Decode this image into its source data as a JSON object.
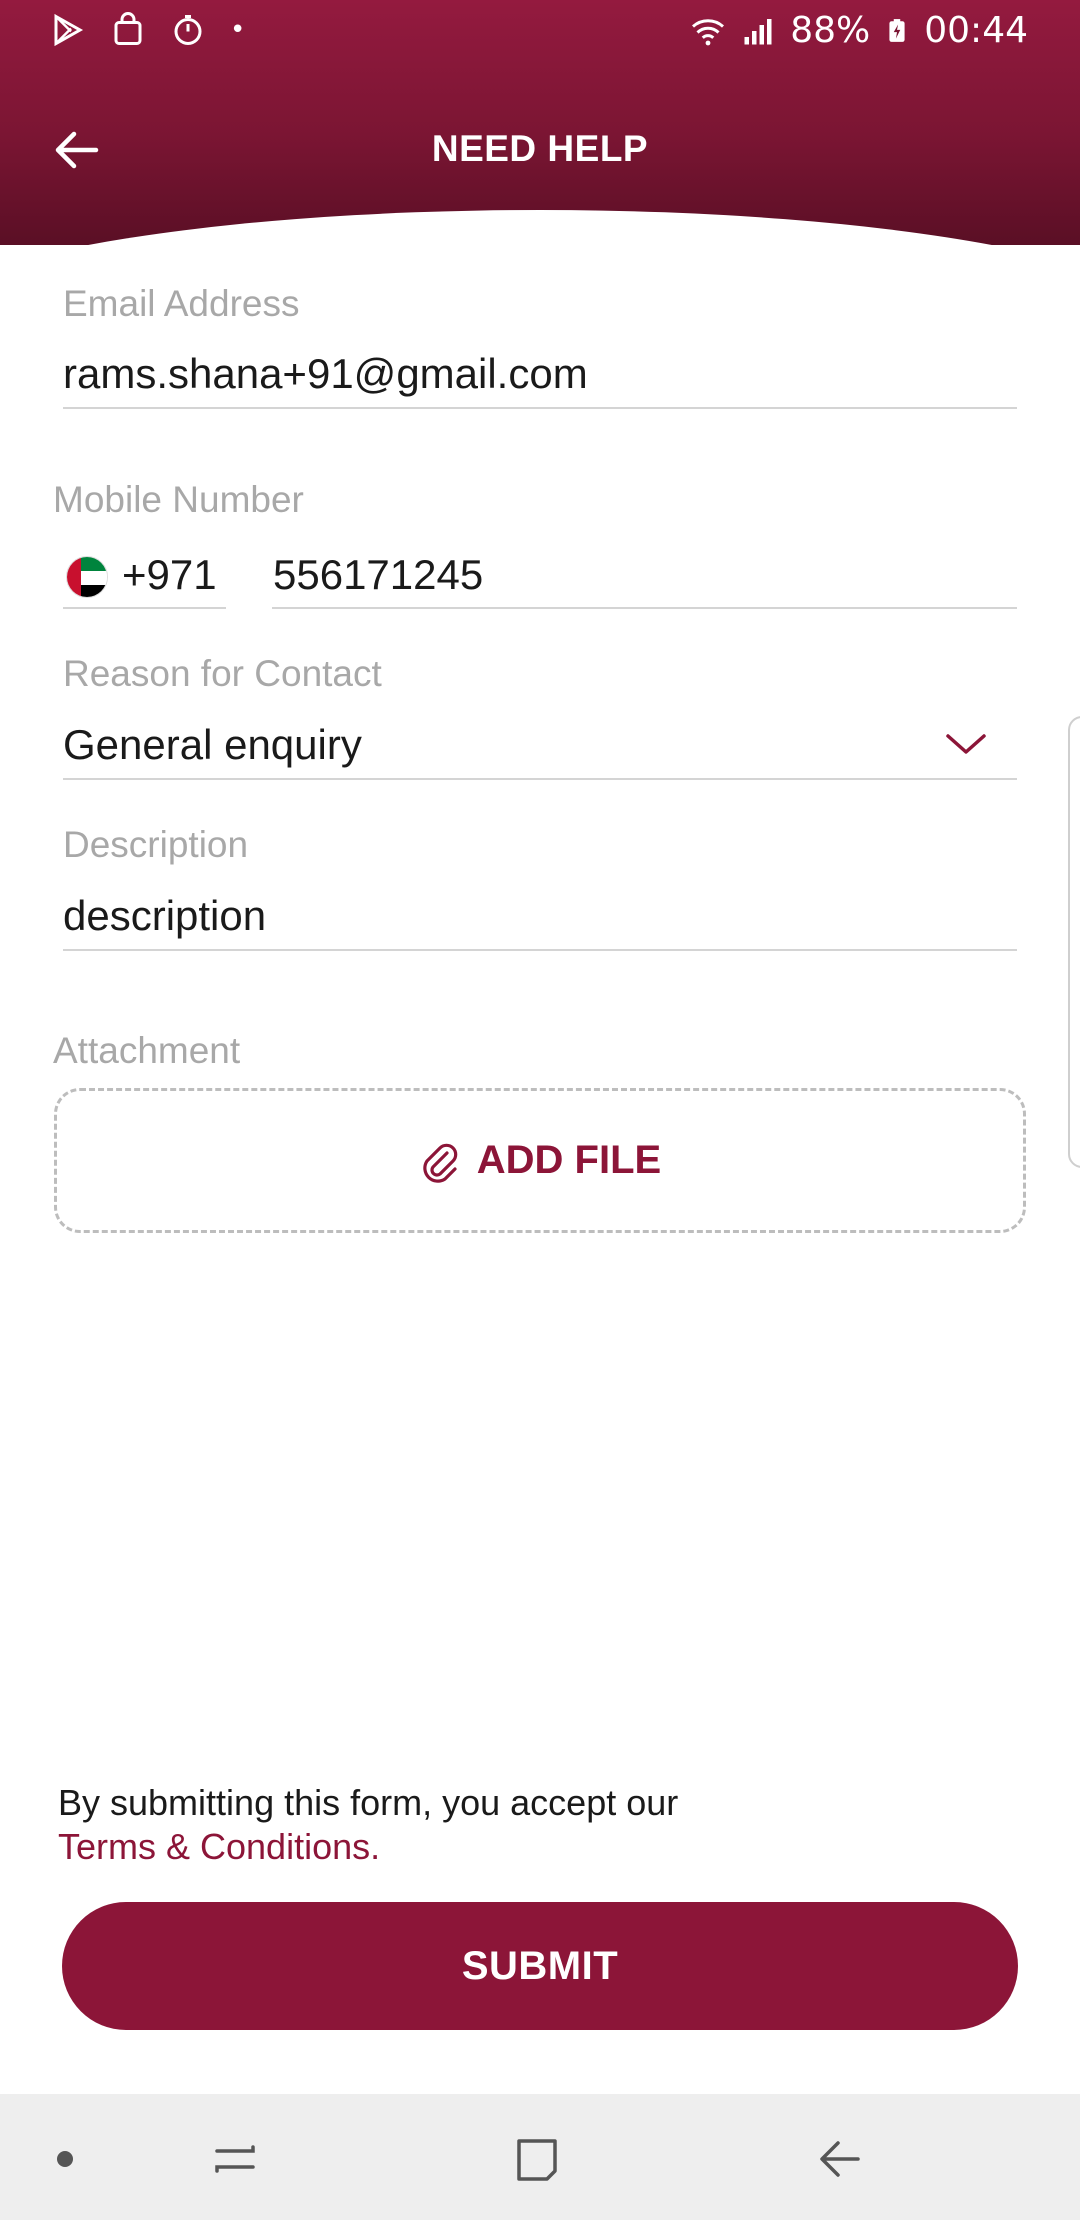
{
  "status_bar": {
    "battery": "88%",
    "time": "00:44",
    "dot": "•"
  },
  "header": {
    "title": "NEED HELP"
  },
  "form": {
    "email": {
      "label": "Email Address",
      "value": "rams.shana+91@gmail.com"
    },
    "mobile": {
      "label": "Mobile Number",
      "country_code": "+971",
      "number": "556171245"
    },
    "reason": {
      "label": "Reason for Contact",
      "value": "General enquiry"
    },
    "description": {
      "label": "Description",
      "value": "description"
    },
    "attachment": {
      "label": "Attachment",
      "button": "ADD FILE"
    }
  },
  "footer": {
    "terms_text": "By submitting this form, you accept our",
    "terms_link": "Terms & Conditions.",
    "submit": "SUBMIT"
  },
  "colors": {
    "brand": "#8c1538",
    "header_dark": "#5a0f25",
    "label_gray": "#a8a8a8"
  },
  "icons": {
    "status_left": [
      "play-store-icon",
      "shopping-bag-icon",
      "timer-icon"
    ],
    "status_right": [
      "wifi-icon",
      "signal-icon",
      "battery-charging-icon"
    ],
    "back": "arrow-left-icon",
    "chevron": "chevron-down-icon",
    "attach": "paperclip-icon",
    "nav": [
      "dot-icon",
      "recents-icon",
      "home-icon",
      "back-icon"
    ]
  }
}
